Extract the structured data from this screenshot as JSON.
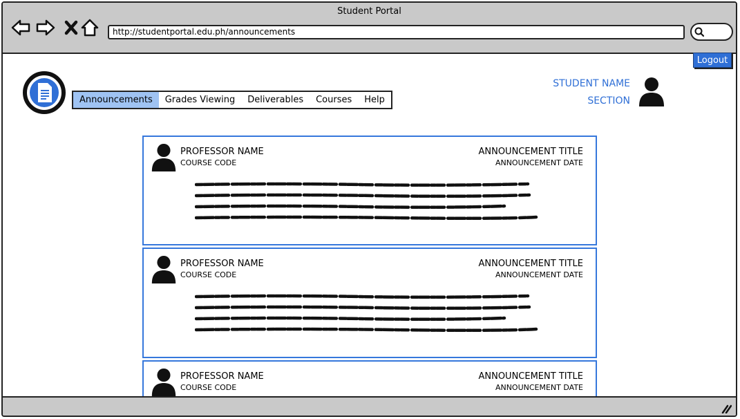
{
  "window": {
    "title": "Student Portal"
  },
  "browser": {
    "url": "http://studentportal.edu.ph/announcements",
    "icons": [
      "back-arrow-icon",
      "forward-arrow-icon",
      "close-x-icon",
      "home-icon",
      "search-icon"
    ]
  },
  "header": {
    "logout_label": "Logout",
    "logo_icon": "document-icon",
    "student_name": "STUDENT NAME",
    "section": "SECTION",
    "accent_color": "#2f6fd6"
  },
  "nav": {
    "items": [
      {
        "label": "Announcements",
        "active": true
      },
      {
        "label": "Grades Viewing",
        "active": false
      },
      {
        "label": "Deliverables",
        "active": false
      },
      {
        "label": "Courses",
        "active": false
      },
      {
        "label": "Help",
        "active": false
      }
    ]
  },
  "announcements": [
    {
      "professor": "PROFESSOR NAME",
      "course_code": "COURSE CODE",
      "title": "ANNOUNCEMENT TITLE",
      "date": "ANNOUNCEMENT DATE"
    },
    {
      "professor": "PROFESSOR NAME",
      "course_code": "COURSE CODE",
      "title": "ANNOUNCEMENT TITLE",
      "date": "ANNOUNCEMENT DATE"
    },
    {
      "professor": "PROFESSOR NAME",
      "course_code": "COURSE CODE",
      "title": "ANNOUNCEMENT TITLE",
      "date": "ANNOUNCEMENT DATE"
    }
  ]
}
